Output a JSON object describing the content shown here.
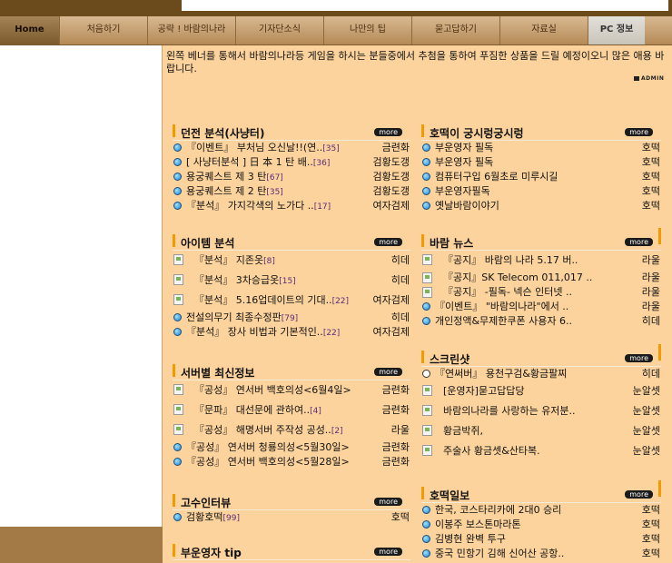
{
  "nav": {
    "items": [
      {
        "label": "Home",
        "width": 66
      },
      {
        "label": "처음하기",
        "width": 97
      },
      {
        "label": "공략 ! 바람의나라",
        "width": 97
      },
      {
        "label": "기자단소식",
        "width": 97
      },
      {
        "label": "나만의  팁",
        "width": 97
      },
      {
        "label": "묻고답하기",
        "width": 97
      },
      {
        "label": "자료실",
        "width": 97
      },
      {
        "label": "PC 정보",
        "width": 62
      }
    ]
  },
  "notice": {
    "text": "왼쪽 베너를 통해서 바람의나라등 게임을 하시는 분들중에서 추첨을 통하여 푸짐한 상품을 드릴 예정이오니 많은 애용 바랍니다.",
    "admin_label": "ADMIN"
  },
  "more_label": "more",
  "sections": {
    "dungeon": {
      "title": "던전 분석(사냥터)",
      "rows": [
        {
          "title": "『이벤트』 부처님 오신날!!(연..",
          "count": "[35]",
          "author": "금련화"
        },
        {
          "title": "[ 사냥터분석 ] 日 本 1 탄 배..",
          "count": "[36]",
          "author": "검황도갱"
        },
        {
          "title": "용궁퀘스트 제 3 탄",
          "count": "[67]",
          "author": "검황도갱"
        },
        {
          "title": "용궁퀘스트 제 2 탄",
          "count": "[35]",
          "author": "검황도갱"
        },
        {
          "title": "『분석』 가지각색의 노가다 ..",
          "count": "[17]",
          "author": "여자검제"
        }
      ]
    },
    "item": {
      "title": "아이템 분석",
      "rows": [
        {
          "title": "『분석』 지존옷",
          "count": "[8]",
          "author": "히데"
        },
        {
          "title": "『분석』 3차승급옷",
          "count": "[15]",
          "author": "히데"
        },
        {
          "title": "『분석』 5.16업데이트의 기대..",
          "count": "[22]",
          "author": "여자검제"
        },
        {
          "title": "전설의무기 최종수정판",
          "count": "[79]",
          "author": "히데"
        },
        {
          "title": "『분석』 장사 비법과 기본적인..",
          "count": "[22]",
          "author": "여자검제"
        }
      ]
    },
    "server": {
      "title": "서버별 최신정보",
      "rows": [
        {
          "title": "『공성』 연서버 백호의성<6월4일>",
          "count": "",
          "author": "금련화"
        },
        {
          "title": "『문파』 대선문에 관하여..",
          "count": "[4]",
          "author": "금련화"
        },
        {
          "title": "『공성』 해명서버 주작성 공성..",
          "count": "[2]",
          "author": "라울"
        },
        {
          "title": "『공성』 연서버 청룡의성<5월30일>",
          "count": "",
          "author": "금련화"
        },
        {
          "title": "『공성』 연서버 백호의성<5월28일>",
          "count": "",
          "author": "금련화"
        }
      ]
    },
    "interview": {
      "title": "고수인터뷰",
      "rows": [
        {
          "title": "검황호떡",
          "count": "[99]",
          "author": "호떡"
        }
      ]
    },
    "tip": {
      "title": "부운영자 tip"
    },
    "palace": {
      "title": "호떡이 궁시렁궁시렁",
      "rows": [
        {
          "title": "부운영자 필독",
          "author": "호떡"
        },
        {
          "title": "부운영자 필독",
          "author": "호떡"
        },
        {
          "title": "컴퓨터구입 6월초로 미루시길",
          "author": "호떡"
        },
        {
          "title": "부운영자필독",
          "author": "호떡"
        },
        {
          "title": "옛날바람이야기",
          "author": "호떡"
        }
      ]
    },
    "news": {
      "title": "바람 뉴스",
      "rows": [
        {
          "title": "『공지』 바람의 나라 5.17 버..",
          "author": "라울"
        },
        {
          "title": "『공지』SK Telecom 011,017 ..",
          "author": "라울"
        },
        {
          "title": "『공지』 -필독- 넥슨 인터넷 ..",
          "author": "라울"
        },
        {
          "title": "『이벤트』 \"바람의나라\"에서 ..",
          "author": "라울"
        },
        {
          "title": "개인정액&무제한쿠폰 사용자 6..",
          "author": "히데"
        }
      ]
    },
    "screenshot": {
      "title": "스크린샷",
      "rows": [
        {
          "title": "『연써버』 용천구검&황금팔찌",
          "author": "히데"
        },
        {
          "title": "[운영자]묻고답답당",
          "author": "눈알셋"
        },
        {
          "title": "바람의나라를 사랑하는 유저분..",
          "author": "눈알셋"
        },
        {
          "title": "황금박쥐,",
          "author": "눈알셋"
        },
        {
          "title": "주술사 황금셋&산타복.",
          "author": "눈알셋"
        }
      ]
    },
    "daily": {
      "title": "호떡일보",
      "rows": [
        {
          "title": "한국, 코스타리카에 2대0 승리",
          "author": "호떡"
        },
        {
          "title": "이봉주 보스톤마라톤",
          "author": "호떡"
        },
        {
          "title": "김병현 완벽 투구",
          "author": "호떡"
        },
        {
          "title": "중국 민항기 김해 신어산 공항..",
          "author": "호떡"
        }
      ]
    }
  }
}
